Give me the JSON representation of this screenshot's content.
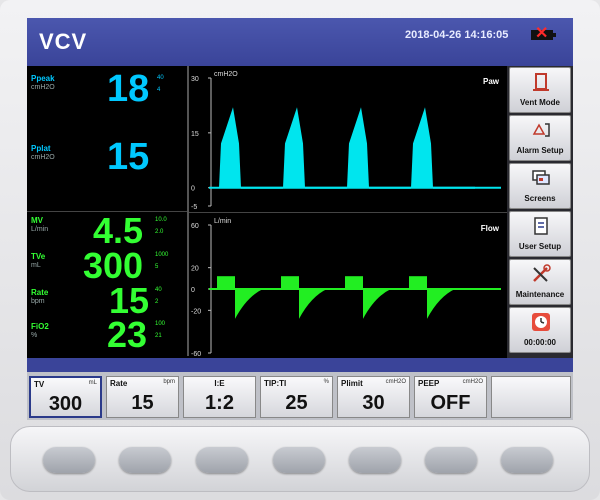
{
  "header": {
    "mode": "VCV",
    "datetime": "2018-04-26   14:16:05"
  },
  "pressure_params": [
    {
      "label": "Ppeak",
      "unit": "cmH2O",
      "value": "18",
      "hi": "40",
      "lo": "4",
      "color": "#00c8ff"
    },
    {
      "label": "Pplat",
      "unit": "cmH2O",
      "value": "15",
      "hi": "",
      "lo": "",
      "color": "#00c8ff"
    }
  ],
  "volume_params": [
    {
      "label": "MV",
      "unit": "L/min",
      "value": "4.5",
      "hi": "10.0",
      "lo": "2.0",
      "color": "#33ff33"
    },
    {
      "label": "TVe",
      "unit": "mL",
      "value": "300",
      "hi": "1000",
      "lo": "5",
      "color": "#33ff33"
    },
    {
      "label": "Rate",
      "unit": "bpm",
      "value": "15",
      "hi": "40",
      "lo": "2",
      "color": "#33ff33"
    },
    {
      "label": "FiO2",
      "unit": "%",
      "value": "23",
      "hi": "100",
      "lo": "21",
      "color": "#33ff33"
    }
  ],
  "waves": [
    {
      "name": "Paw",
      "unit": "cmH2O",
      "ticks": [
        "30",
        "15",
        "0",
        "-5"
      ],
      "color": "#00e5ee",
      "range": [
        -5,
        30
      ],
      "peak": 22
    },
    {
      "name": "Flow",
      "unit": "L/min",
      "ticks": [
        "60",
        "20",
        "0",
        "-20",
        "-60"
      ],
      "color": "#22ee22",
      "range": [
        -60,
        60
      ],
      "insp": 12,
      "exp": -28
    }
  ],
  "side_buttons": [
    {
      "label": "Vent Mode",
      "icon": "vent-mode-icon"
    },
    {
      "label": "Alarm Setup",
      "icon": "alarm-setup-icon"
    },
    {
      "label": "Screens",
      "icon": "screens-icon"
    },
    {
      "label": "User Setup",
      "icon": "user-setup-icon"
    },
    {
      "label": "Maintenance",
      "icon": "maintenance-icon"
    },
    {
      "label": "00:00:00",
      "icon": "timer-icon"
    }
  ],
  "settings": [
    {
      "name": "TV",
      "unit": "mL",
      "value": "300"
    },
    {
      "name": "Rate",
      "unit": "bpm",
      "value": "15"
    },
    {
      "name": "I:E",
      "unit": "",
      "value": "1:2"
    },
    {
      "name": "TIP:TI",
      "unit": "%",
      "value": "25"
    },
    {
      "name": "Plimit",
      "unit": "cmH2O",
      "value": "30"
    },
    {
      "name": "PEEP",
      "unit": "cmH2O",
      "value": "OFF"
    },
    {
      "name": "",
      "unit": "",
      "value": ""
    }
  ],
  "colors": {
    "header": "#3a4499",
    "pressure": "#00c8ff",
    "volume": "#33ff33"
  }
}
